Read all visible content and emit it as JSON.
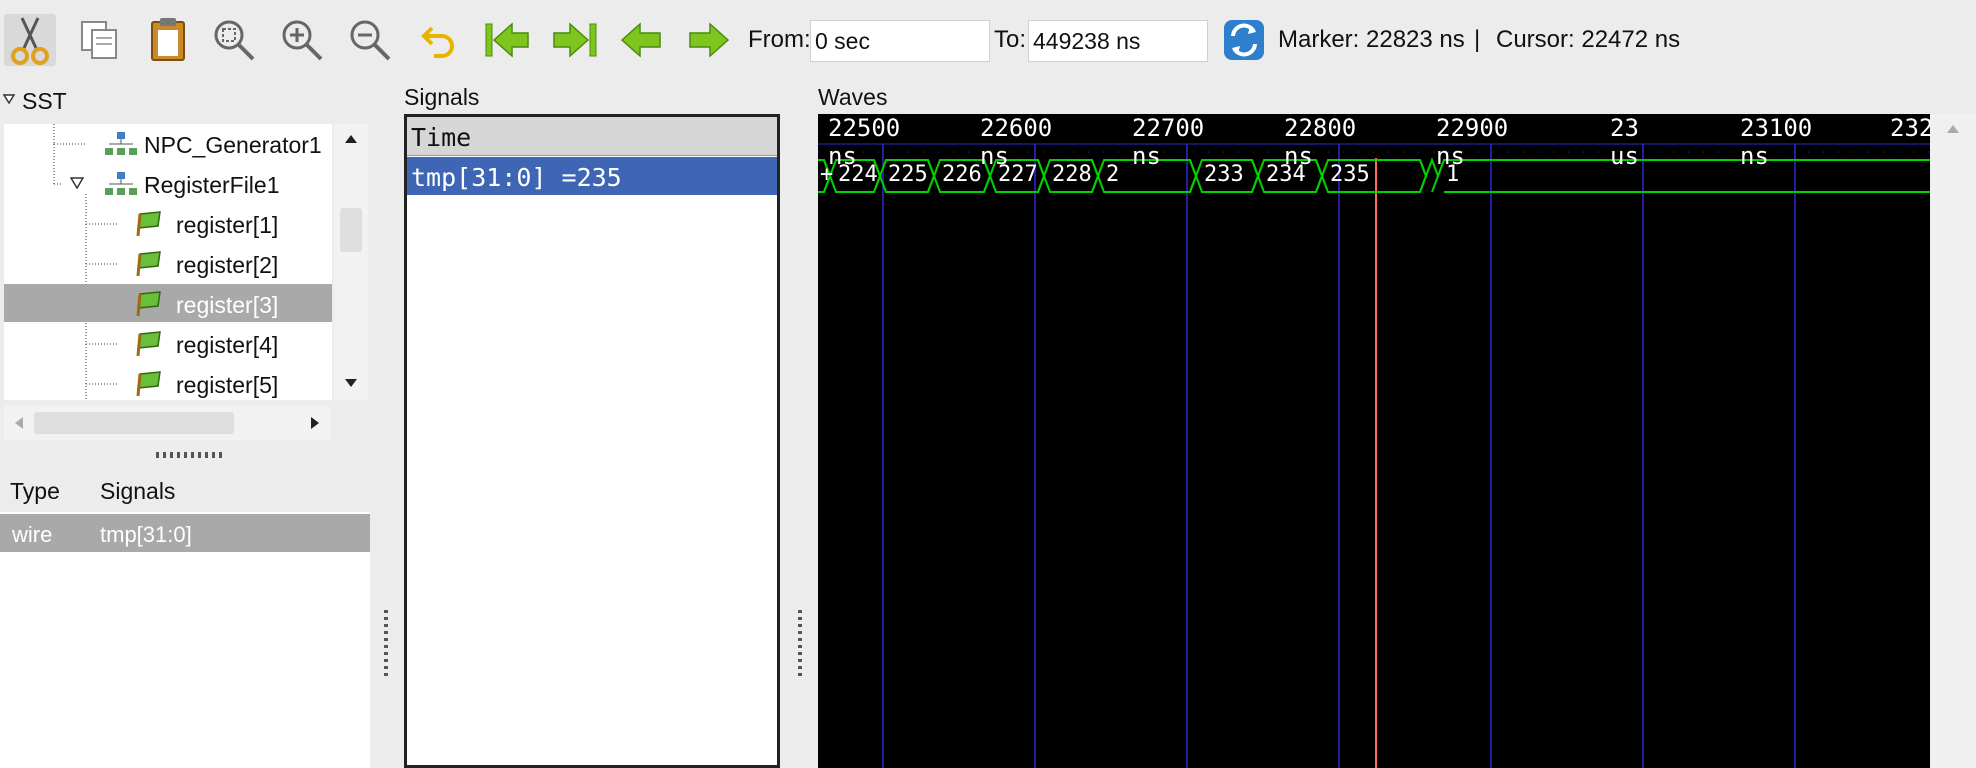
{
  "toolbar": {
    "from_label": "From:",
    "from_value": "0 sec",
    "to_label": "To:",
    "to_value": "449238 ns",
    "marker_text": "Marker: 22823 ns",
    "separator": "|",
    "cursor_text": "Cursor: 22472 ns",
    "icons": [
      "scissors-icon",
      "copy-icon",
      "paste-icon",
      "zoom-fit-icon",
      "zoom-in-icon",
      "zoom-out-icon",
      "undo-icon",
      "jump-start-icon",
      "jump-end-icon",
      "step-back-icon",
      "step-forward-icon",
      "reload-icon"
    ]
  },
  "sst": {
    "title": "SST",
    "items": [
      {
        "label": "NPC_Generator1"
      },
      {
        "label": "RegisterFile1"
      },
      {
        "label": "register[1]"
      },
      {
        "label": "register[2]"
      },
      {
        "label": "register[3]"
      },
      {
        "label": "register[4]"
      },
      {
        "label": "register[5]"
      }
    ]
  },
  "type_signals": {
    "type_header": "Type",
    "signals_header": "Signals",
    "row_type": "wire",
    "row_signal": "tmp[31:0]"
  },
  "signals_panel": {
    "title": "Signals",
    "time_label": "Time",
    "signal_row": "tmp[31:0] =235"
  },
  "waves": {
    "title": "Waves",
    "time_ticks": [
      "22500 ns",
      "22600 ns",
      "22700 ns",
      "22800 ns",
      "22900 ns",
      "23 us",
      "23100 ns",
      "232"
    ],
    "values": [
      "+",
      "224",
      "225",
      "226",
      "227",
      "228",
      "2",
      "233",
      "234",
      "235",
      "1"
    ],
    "colors": {
      "wave": "#00d200",
      "grid": "#2b2bcf",
      "marker": "#ff6a5a",
      "selection": "#3f66b5"
    }
  }
}
